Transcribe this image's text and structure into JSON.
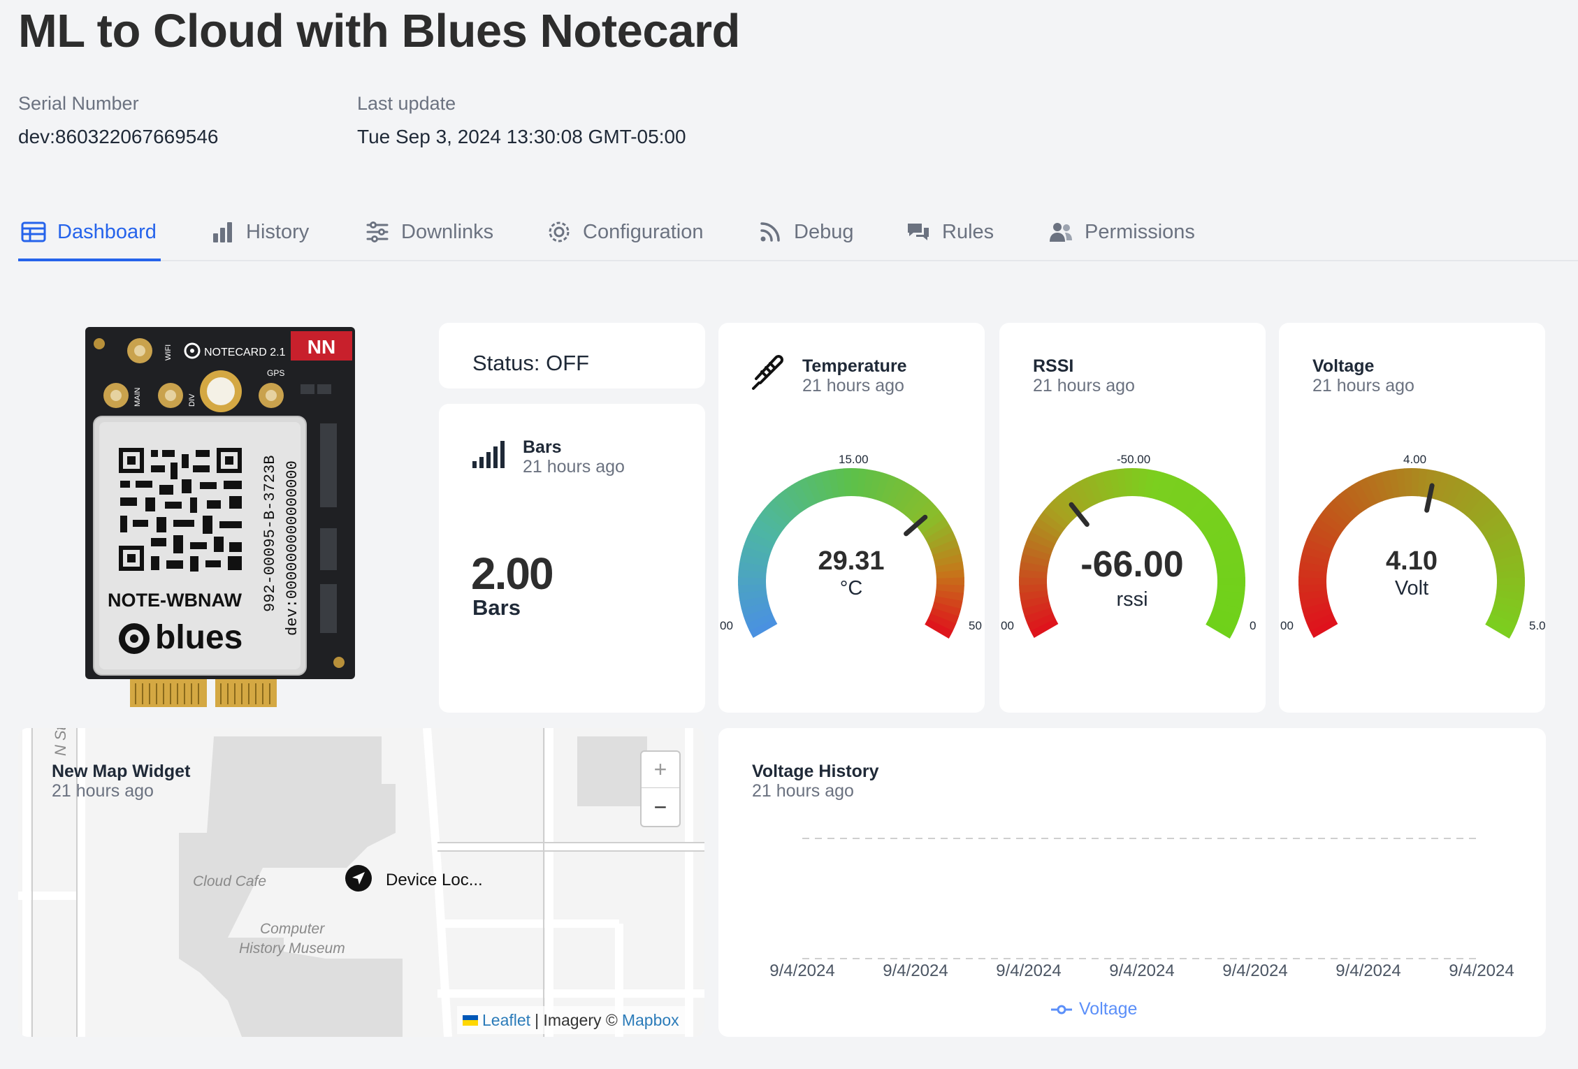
{
  "page": {
    "title": "ML to Cloud with Blues Notecard",
    "serial_label": "Serial Number",
    "serial_value": "dev:860322067669546",
    "update_label": "Last update",
    "update_value": "Tue Sep 3, 2024 13:30:08 GMT-05:00"
  },
  "tabs": [
    {
      "label": "Dashboard",
      "icon": "table-icon",
      "active": true
    },
    {
      "label": "History",
      "icon": "bar-chart-icon"
    },
    {
      "label": "Downlinks",
      "icon": "sliders-icon"
    },
    {
      "label": "Configuration",
      "icon": "gear-icon"
    },
    {
      "label": "Debug",
      "icon": "rss-icon"
    },
    {
      "label": "Rules",
      "icon": "chat-icon"
    },
    {
      "label": "Permissions",
      "icon": "users-icon"
    }
  ],
  "device_image": {
    "board_label": "NOTECARD 2.1",
    "model": "NOTE-WBNAW",
    "part_number": "992-00095-B-3723B",
    "device_id": "dev:000000000000000",
    "brand": "blues",
    "antenna_labels": [
      "WIFI",
      "MAIN",
      "DIV",
      "GPS"
    ]
  },
  "status_widget": {
    "text": "Status: OFF"
  },
  "bars_widget": {
    "title": "Bars",
    "time": "21 hours ago",
    "value": "2.00",
    "unit": "Bars"
  },
  "gauges": {
    "temperature": {
      "title": "Temperature",
      "time": "21 hours ago",
      "value": "29.31",
      "unit": "°C",
      "min_label": "00",
      "mid_label": "15.00",
      "max_label": "50",
      "min": -20,
      "max": 50,
      "needle": 29.31
    },
    "rssi": {
      "title": "RSSI",
      "time": "21 hours ago",
      "value": "-66.00",
      "unit": "rssi",
      "min_label": "00",
      "mid_label": "-50.00",
      "max_label": "0",
      "min": -100,
      "max": 0,
      "needle": -66
    },
    "voltage": {
      "title": "Voltage",
      "time": "21 hours ago",
      "value": "4.10",
      "unit": "Volt",
      "min_label": "00",
      "mid_label": "4.00",
      "max_label": "5.0",
      "min": 3,
      "max": 5,
      "needle": 4.1
    }
  },
  "map_widget": {
    "title": "New Map Widget",
    "time": "21 hours ago",
    "marker_label": "Device Loc...",
    "zoom_in": "+",
    "zoom_out": "−",
    "places": [
      "Cloud Cafe",
      "Computer",
      "History Museum",
      "N St"
    ],
    "attribution": {
      "leaflet": "Leaflet",
      "sep": "| Imagery ©",
      "mapbox": "Mapbox"
    }
  },
  "voltage_history": {
    "title": "Voltage History",
    "time": "21 hours ago",
    "legend": "Voltage"
  },
  "chart_data": {
    "type": "line",
    "title": "Voltage History",
    "x": [
      "9/4/2024",
      "9/4/2024",
      "9/4/2024",
      "9/4/2024",
      "9/4/2024",
      "9/4/2024",
      "9/4/2024"
    ],
    "series": [
      {
        "name": "Voltage",
        "values": []
      }
    ],
    "grid": true,
    "legend_position": "bottom"
  },
  "colors": {
    "accent": "#2563eb",
    "link": "#2b7bb9"
  }
}
